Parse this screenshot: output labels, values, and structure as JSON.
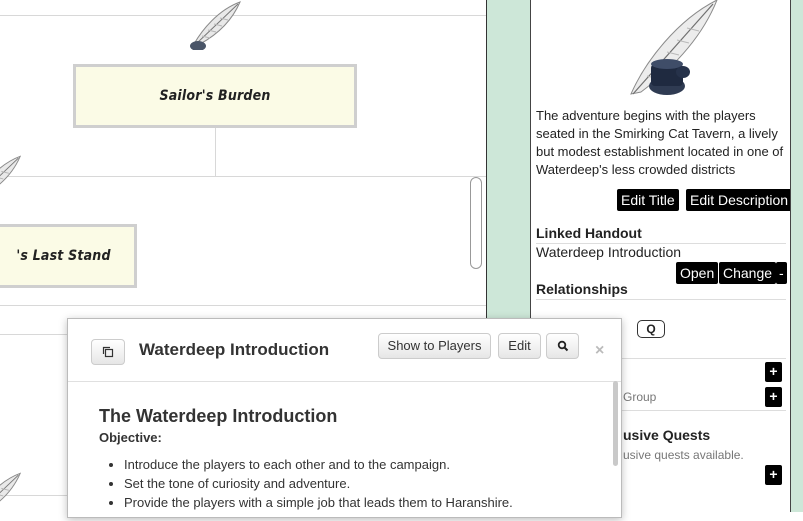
{
  "canvas": {
    "nodes": [
      {
        "title": "Sailor's Burden"
      },
      {
        "title": "'s Last Stand"
      }
    ]
  },
  "panel": {
    "image_icon": "quill-inkwell-icon",
    "description": "The adventure begins with the players seated in the Smirking Cat Tavern, a lively but modest establishment located in one of Waterdeep's less crowded districts",
    "edit_title_label": "Edit Title",
    "edit_description_label": "Edit Description",
    "linked_handout": {
      "heading": "Linked Handout",
      "name": "Waterdeep Introduction",
      "open_label": "Open",
      "change_label": "Change",
      "remove_label": "-"
    },
    "relationships": {
      "heading": "Relationships",
      "q_label": "Q",
      "add_label": "+",
      "group_label": "Group",
      "group_add_label": "+"
    },
    "exclusive": {
      "heading": "usive Quests",
      "empty_text": "usive quests available.",
      "add_label": "+"
    }
  },
  "dialog": {
    "popout_icon": "popout-icon",
    "title": "Waterdeep Introduction",
    "show_players_label": "Show to Players",
    "edit_label": "Edit",
    "search_icon": "search-icon",
    "close_label": "×",
    "content": {
      "heading": "The Waterdeep Introduction",
      "objective_label": "Objective:",
      "objectives": [
        "Introduce the players to each other and to the campaign.",
        "Set the tone of curiosity and adventure.",
        "Provide the players with a simple job that leads them to Haranshire."
      ]
    }
  },
  "colors": {
    "node_fill": "#fbfbe6",
    "gutter": "#cde7d8",
    "button_dark": "#000000"
  }
}
